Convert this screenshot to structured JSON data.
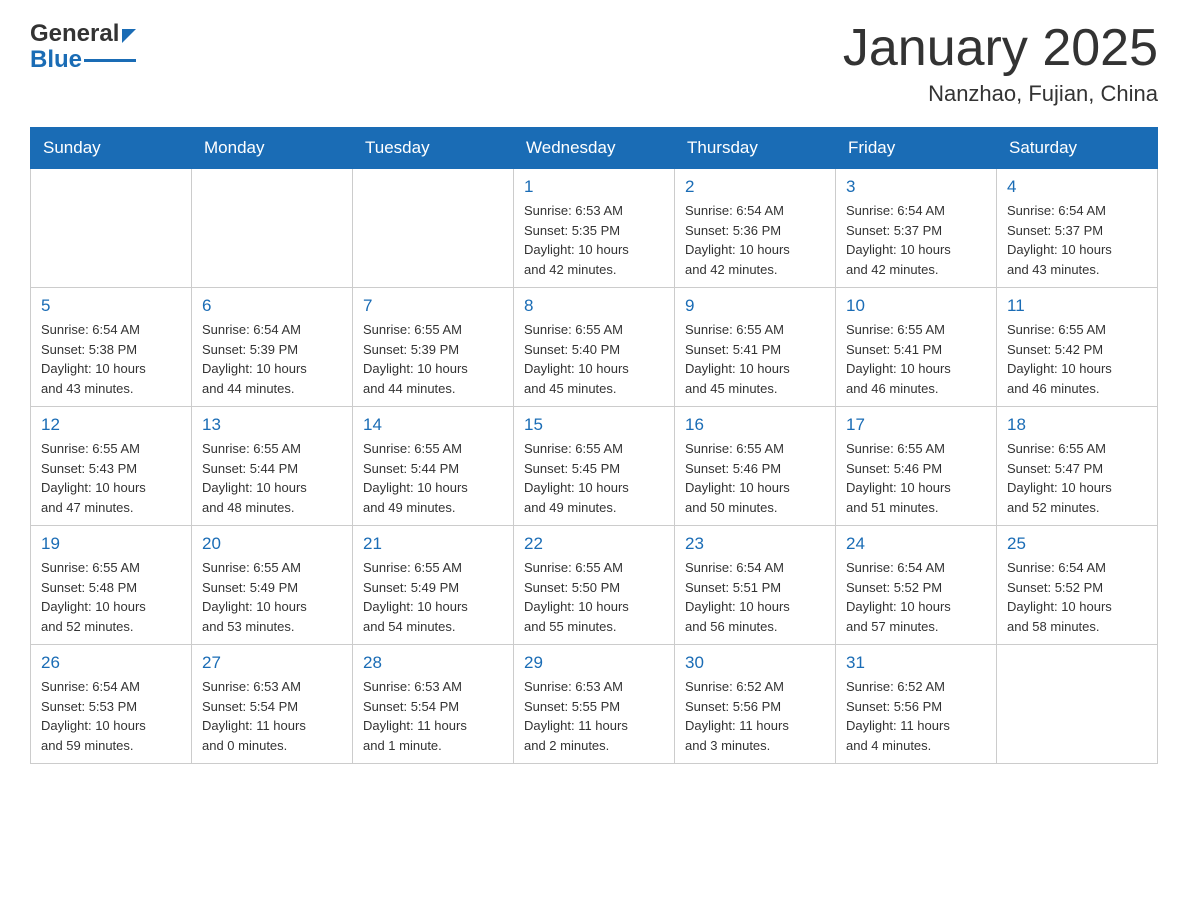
{
  "header": {
    "logo_general": "General",
    "logo_blue": "Blue",
    "month_title": "January 2025",
    "location": "Nanzhao, Fujian, China"
  },
  "calendar": {
    "days_of_week": [
      "Sunday",
      "Monday",
      "Tuesday",
      "Wednesday",
      "Thursday",
      "Friday",
      "Saturday"
    ],
    "weeks": [
      [
        {
          "day": "",
          "info": ""
        },
        {
          "day": "",
          "info": ""
        },
        {
          "day": "",
          "info": ""
        },
        {
          "day": "1",
          "info": "Sunrise: 6:53 AM\nSunset: 5:35 PM\nDaylight: 10 hours\nand 42 minutes."
        },
        {
          "day": "2",
          "info": "Sunrise: 6:54 AM\nSunset: 5:36 PM\nDaylight: 10 hours\nand 42 minutes."
        },
        {
          "day": "3",
          "info": "Sunrise: 6:54 AM\nSunset: 5:37 PM\nDaylight: 10 hours\nand 42 minutes."
        },
        {
          "day": "4",
          "info": "Sunrise: 6:54 AM\nSunset: 5:37 PM\nDaylight: 10 hours\nand 43 minutes."
        }
      ],
      [
        {
          "day": "5",
          "info": "Sunrise: 6:54 AM\nSunset: 5:38 PM\nDaylight: 10 hours\nand 43 minutes."
        },
        {
          "day": "6",
          "info": "Sunrise: 6:54 AM\nSunset: 5:39 PM\nDaylight: 10 hours\nand 44 minutes."
        },
        {
          "day": "7",
          "info": "Sunrise: 6:55 AM\nSunset: 5:39 PM\nDaylight: 10 hours\nand 44 minutes."
        },
        {
          "day": "8",
          "info": "Sunrise: 6:55 AM\nSunset: 5:40 PM\nDaylight: 10 hours\nand 45 minutes."
        },
        {
          "day": "9",
          "info": "Sunrise: 6:55 AM\nSunset: 5:41 PM\nDaylight: 10 hours\nand 45 minutes."
        },
        {
          "day": "10",
          "info": "Sunrise: 6:55 AM\nSunset: 5:41 PM\nDaylight: 10 hours\nand 46 minutes."
        },
        {
          "day": "11",
          "info": "Sunrise: 6:55 AM\nSunset: 5:42 PM\nDaylight: 10 hours\nand 46 minutes."
        }
      ],
      [
        {
          "day": "12",
          "info": "Sunrise: 6:55 AM\nSunset: 5:43 PM\nDaylight: 10 hours\nand 47 minutes."
        },
        {
          "day": "13",
          "info": "Sunrise: 6:55 AM\nSunset: 5:44 PM\nDaylight: 10 hours\nand 48 minutes."
        },
        {
          "day": "14",
          "info": "Sunrise: 6:55 AM\nSunset: 5:44 PM\nDaylight: 10 hours\nand 49 minutes."
        },
        {
          "day": "15",
          "info": "Sunrise: 6:55 AM\nSunset: 5:45 PM\nDaylight: 10 hours\nand 49 minutes."
        },
        {
          "day": "16",
          "info": "Sunrise: 6:55 AM\nSunset: 5:46 PM\nDaylight: 10 hours\nand 50 minutes."
        },
        {
          "day": "17",
          "info": "Sunrise: 6:55 AM\nSunset: 5:46 PM\nDaylight: 10 hours\nand 51 minutes."
        },
        {
          "day": "18",
          "info": "Sunrise: 6:55 AM\nSunset: 5:47 PM\nDaylight: 10 hours\nand 52 minutes."
        }
      ],
      [
        {
          "day": "19",
          "info": "Sunrise: 6:55 AM\nSunset: 5:48 PM\nDaylight: 10 hours\nand 52 minutes."
        },
        {
          "day": "20",
          "info": "Sunrise: 6:55 AM\nSunset: 5:49 PM\nDaylight: 10 hours\nand 53 minutes."
        },
        {
          "day": "21",
          "info": "Sunrise: 6:55 AM\nSunset: 5:49 PM\nDaylight: 10 hours\nand 54 minutes."
        },
        {
          "day": "22",
          "info": "Sunrise: 6:55 AM\nSunset: 5:50 PM\nDaylight: 10 hours\nand 55 minutes."
        },
        {
          "day": "23",
          "info": "Sunrise: 6:54 AM\nSunset: 5:51 PM\nDaylight: 10 hours\nand 56 minutes."
        },
        {
          "day": "24",
          "info": "Sunrise: 6:54 AM\nSunset: 5:52 PM\nDaylight: 10 hours\nand 57 minutes."
        },
        {
          "day": "25",
          "info": "Sunrise: 6:54 AM\nSunset: 5:52 PM\nDaylight: 10 hours\nand 58 minutes."
        }
      ],
      [
        {
          "day": "26",
          "info": "Sunrise: 6:54 AM\nSunset: 5:53 PM\nDaylight: 10 hours\nand 59 minutes."
        },
        {
          "day": "27",
          "info": "Sunrise: 6:53 AM\nSunset: 5:54 PM\nDaylight: 11 hours\nand 0 minutes."
        },
        {
          "day": "28",
          "info": "Sunrise: 6:53 AM\nSunset: 5:54 PM\nDaylight: 11 hours\nand 1 minute."
        },
        {
          "day": "29",
          "info": "Sunrise: 6:53 AM\nSunset: 5:55 PM\nDaylight: 11 hours\nand 2 minutes."
        },
        {
          "day": "30",
          "info": "Sunrise: 6:52 AM\nSunset: 5:56 PM\nDaylight: 11 hours\nand 3 minutes."
        },
        {
          "day": "31",
          "info": "Sunrise: 6:52 AM\nSunset: 5:56 PM\nDaylight: 11 hours\nand 4 minutes."
        },
        {
          "day": "",
          "info": ""
        }
      ]
    ]
  }
}
